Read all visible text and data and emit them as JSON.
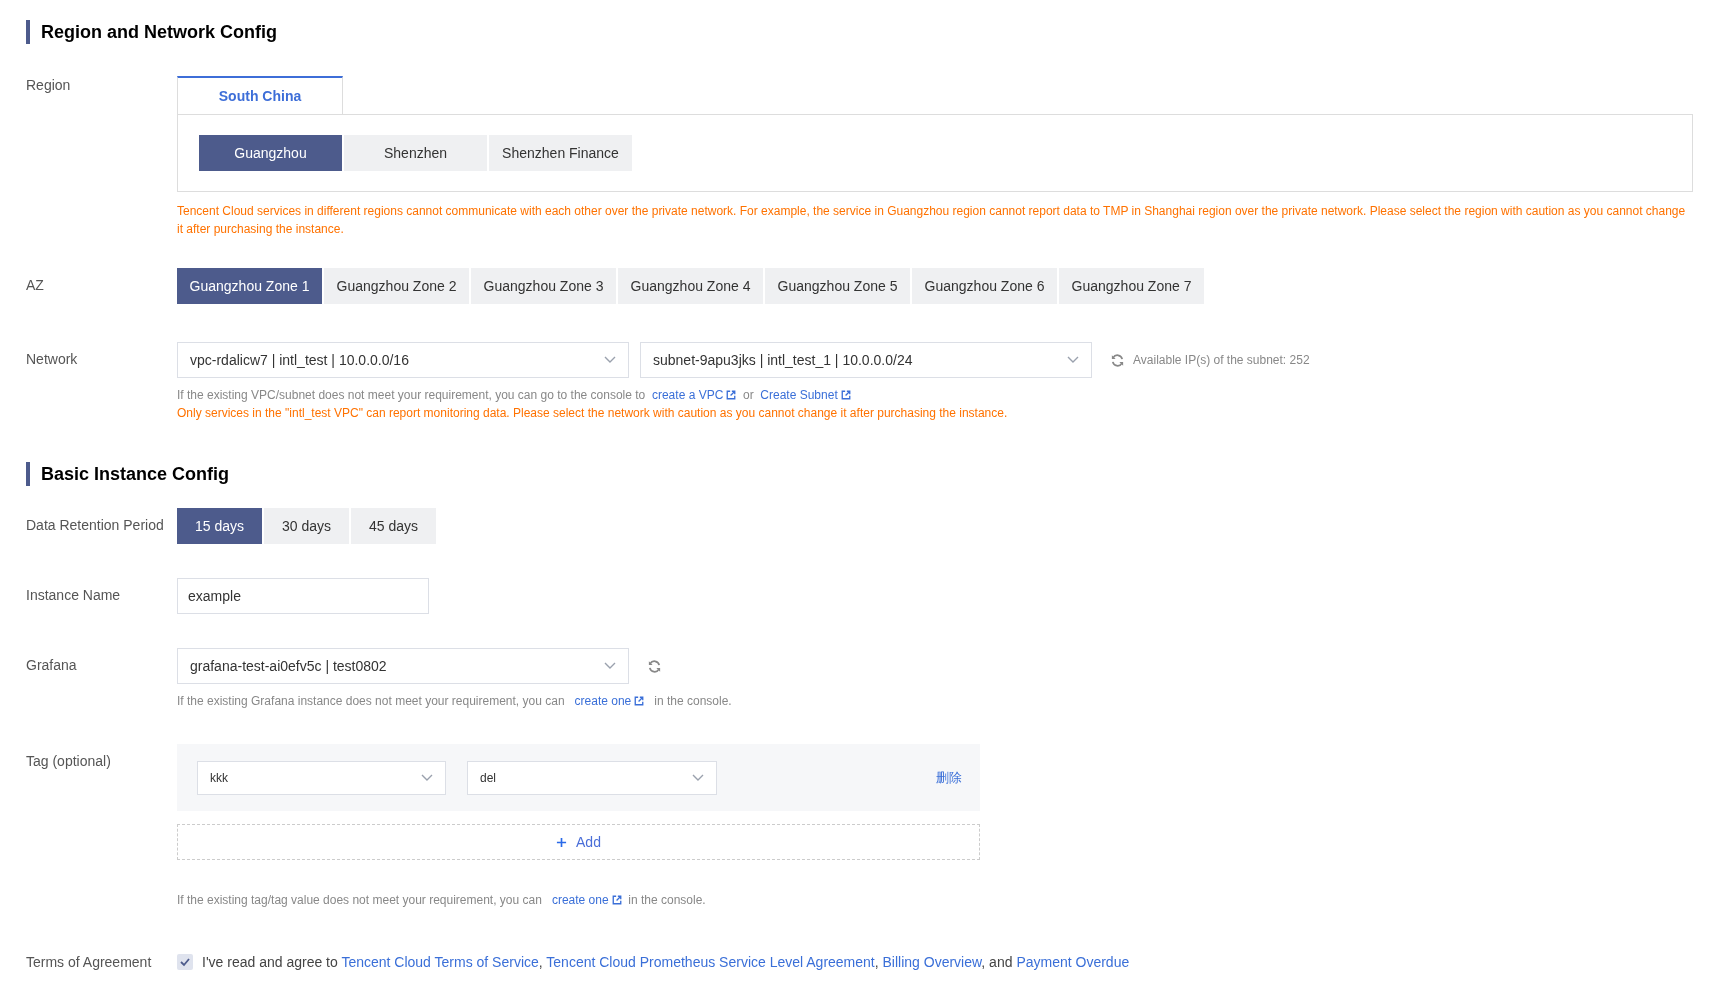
{
  "region_section": {
    "title": "Region and Network Config",
    "region": {
      "label": "Region",
      "areas": [
        {
          "label": "South China",
          "selected": true
        }
      ],
      "cities": [
        {
          "label": "Guangzhou",
          "selected": true
        },
        {
          "label": "Shenzhen",
          "selected": false
        },
        {
          "label": "Shenzhen Finance",
          "selected": false
        }
      ],
      "warning": "Tencent Cloud services in different regions cannot communicate with each other over the private network. For example, the service in Guangzhou region cannot report data to TMP in Shanghai region over the private network. Please select the region with caution as you cannot change it after purchasing the instance."
    },
    "az": {
      "label": "AZ",
      "zones": [
        {
          "label": "Guangzhou Zone 1",
          "selected": true
        },
        {
          "label": "Guangzhou Zone 2",
          "selected": false
        },
        {
          "label": "Guangzhou Zone 3",
          "selected": false
        },
        {
          "label": "Guangzhou Zone 4",
          "selected": false
        },
        {
          "label": "Guangzhou Zone 5",
          "selected": false
        },
        {
          "label": "Guangzhou Zone 6",
          "selected": false
        },
        {
          "label": "Guangzhou Zone 7",
          "selected": false
        }
      ]
    },
    "network": {
      "label": "Network",
      "vpc": "vpc-rdalicw7 | intl_test | 10.0.0.0/16",
      "subnet": "subnet-9apu3jks | intl_test_1 | 10.0.0.0/24",
      "available_ips": "Available IP(s) of the subnet: 252",
      "hint": {
        "before": "If the existing VPC/subnet does not meet your requirement, you can go to the console to",
        "link1": "create a VPC",
        "middle": "or",
        "link2": "Create Subnet"
      },
      "warning": "Only services in the \"intl_test VPC\" can report monitoring data. Please select the network with caution as you cannot change it after purchasing the instance."
    }
  },
  "basic_section": {
    "title": "Basic Instance Config",
    "retention": {
      "label": "Data Retention Period",
      "options": [
        {
          "label": "15 days",
          "selected": true
        },
        {
          "label": "30 days",
          "selected": false
        },
        {
          "label": "45 days",
          "selected": false
        }
      ]
    },
    "instance_name": {
      "label": "Instance Name",
      "value": "example"
    },
    "grafana": {
      "label": "Grafana",
      "value": "grafana-test-ai0efv5c | test0802",
      "hint": {
        "before": "If the existing Grafana instance does not meet your requirement, you can",
        "link": "create one",
        "after": "in the console."
      }
    },
    "tag": {
      "label": "Tag (optional)",
      "rows": [
        {
          "key": "kkk",
          "value": "del",
          "delete": "删除"
        }
      ],
      "add": "Add",
      "hint": {
        "before": "If the existing tag/tag value does not meet your requirement, you can",
        "link": "create one",
        "after": "in the console."
      }
    },
    "terms": {
      "label": "Terms of Agreement",
      "checked": true,
      "parts": [
        {
          "kind": "text",
          "text": "I've read and agree to "
        },
        {
          "kind": "link",
          "text": "Tencent Cloud Terms of Service"
        },
        {
          "kind": "text",
          "text": ", "
        },
        {
          "kind": "link",
          "text": "Tencent Cloud Prometheus Service Level Agreement"
        },
        {
          "kind": "text",
          "text": ", "
        },
        {
          "kind": "link",
          "text": "Billing Overview"
        },
        {
          "kind": "text",
          "text": ", and "
        },
        {
          "kind": "link",
          "text": "Payment Overdue"
        }
      ]
    }
  }
}
